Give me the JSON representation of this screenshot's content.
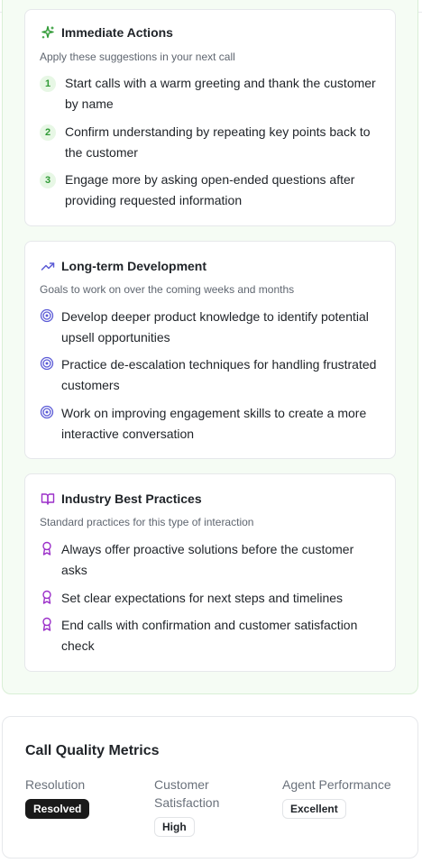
{
  "immediate": {
    "title": "Immediate Actions",
    "subtitle": "Apply these suggestions in your next call",
    "items": [
      {
        "num": "1",
        "text": "Start calls with a warm greeting and thank the customer by name"
      },
      {
        "num": "2",
        "text": "Confirm understanding by repeating key points back to the customer"
      },
      {
        "num": "3",
        "text": "Engage more by asking open-ended questions after providing requested information"
      }
    ]
  },
  "longterm": {
    "title": "Long-term Development",
    "subtitle": "Goals to work on over the coming weeks and months",
    "items": [
      {
        "text": "Develop deeper product knowledge to identify potential upsell opportunities"
      },
      {
        "text": "Practice de-escalation techniques for handling frustrated customers"
      },
      {
        "text": "Work on improving engagement skills to create a more interactive conversation"
      }
    ]
  },
  "industry": {
    "title": "Industry Best Practices",
    "subtitle": "Standard practices for this type of interaction",
    "items": [
      {
        "text": "Always offer proactive solutions before the customer asks"
      },
      {
        "text": "Set clear expectations for next steps and timelines"
      },
      {
        "text": "End calls with confirmation and customer satisfaction check"
      }
    ]
  },
  "metrics": {
    "title": "Call Quality Metrics",
    "resolution": {
      "label": "Resolution",
      "value": "Resolved"
    },
    "satisfaction": {
      "label_line1": "Customer",
      "label_line2": "Satisfaction",
      "value": "High"
    },
    "performance": {
      "label": "Agent Performance",
      "value": "Excellent"
    }
  },
  "colors": {
    "immediate_accent": "#2f9a35",
    "longterm_accent": "#5b5bd6",
    "industry_accent": "#9b2fc9",
    "panel_bg": "#f5fcf4"
  },
  "icons": {
    "immediate": "sparkle-icon",
    "longterm": "trending-up-icon",
    "longterm_bullet": "target-icon",
    "industry": "book-icon",
    "industry_bullet": "award-icon"
  }
}
